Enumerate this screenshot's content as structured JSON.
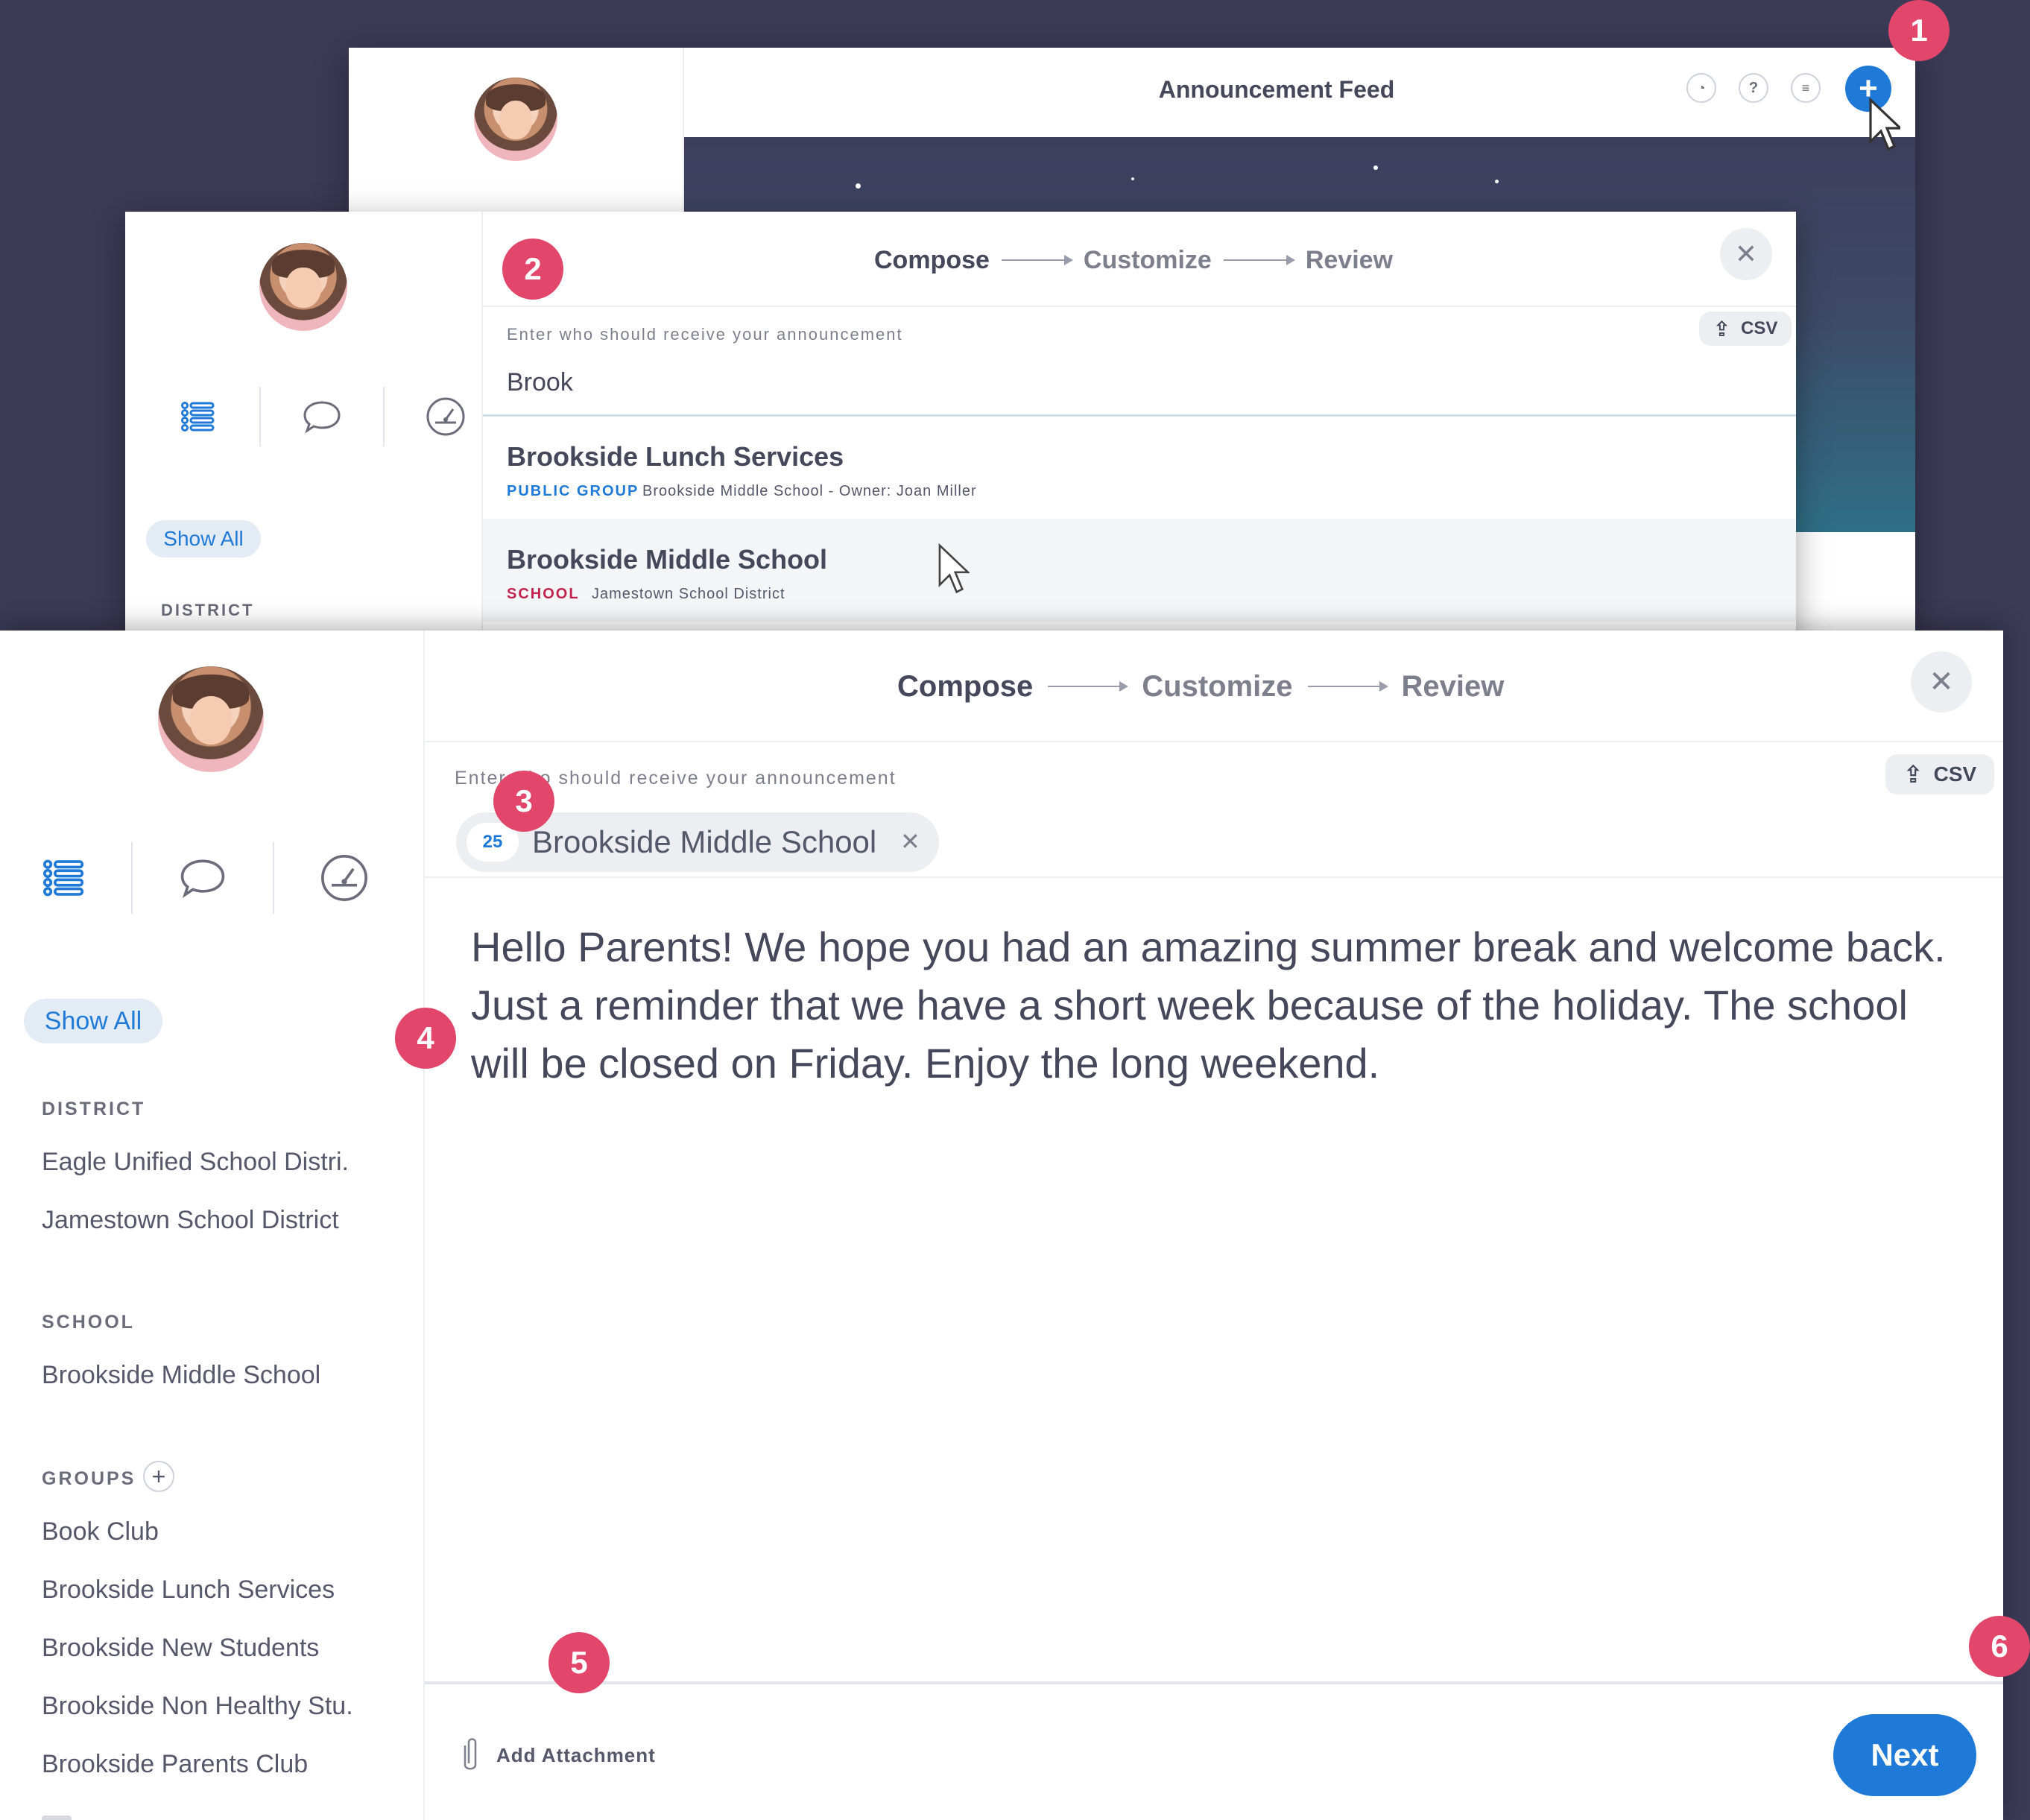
{
  "badges": [
    "1",
    "2",
    "3",
    "4",
    "5",
    "6"
  ],
  "feed_window": {
    "title": "Announcement Feed",
    "icons": [
      "bell-icon",
      "help-icon",
      "inbox-icon"
    ],
    "add_icon": "plus-icon"
  },
  "steps": {
    "compose": "Compose",
    "customize": "Customize",
    "review": "Review"
  },
  "compose_search": {
    "label": "Enter who should receive your announcement",
    "value": "Brook",
    "csv_label": "CSV",
    "results": [
      {
        "name": "Brookside Lunch Services",
        "type": "PUBLIC GROUP",
        "type_color": "#1f79d6",
        "detail": "Brookside Middle School - Owner: Joan Miller"
      },
      {
        "name": "Brookside Middle School",
        "type": "SCHOOL",
        "type_color": "#c0234e",
        "detail": "Jamestown School District"
      }
    ]
  },
  "sidebar": {
    "show_all": "Show All",
    "district_label": "DISTRICT",
    "districts": [
      "Eagle Unified School Distri.",
      "Jamestown School District"
    ],
    "school_label": "SCHOOL",
    "schools": [
      "Brookside Middle School"
    ],
    "groups_label": "GROUPS",
    "groups": [
      "Book Club",
      "Brookside Lunch Services",
      "Brookside New Students",
      "Brookside Non Healthy Stu.",
      "Brookside Parents Club"
    ]
  },
  "compose_main": {
    "label": "Enter who should receive your announcement",
    "csv_label": "CSV",
    "recipient": {
      "count": "25",
      "name": "Brookside Middle School"
    },
    "message": "Hello Parents! We hope you had an amazing summer break and welcome back. Just a reminder that we have a short week because of the holiday. The school will be closed on Friday. Enjoy the long weekend.",
    "attachment_label": "Add Attachment",
    "next_label": "Next"
  },
  "colors": {
    "background": "#3b3a57",
    "accent": "#1f79d6",
    "badge": "#e2466b"
  }
}
